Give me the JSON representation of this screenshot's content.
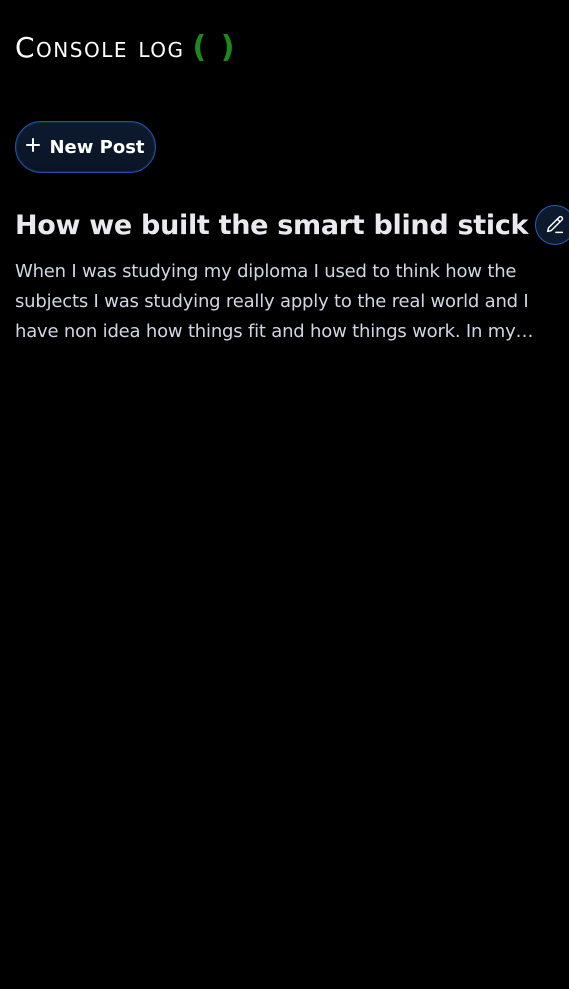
{
  "header": {
    "brand": "Console log",
    "brand_suffix": "( )"
  },
  "actions": {
    "new_post_label": "New Post"
  },
  "posts": [
    {
      "title": "How we built the smart blind stick",
      "excerpt": "When I was studying my diploma I used to think how the subjects I was studying really apply to the real world and I have non idea how things fit and how things work. In my…",
      "edit_icon": "pencil-icon"
    }
  ],
  "colors": {
    "background": "#000000",
    "accent_green": "#1b8a1b",
    "button_border": "#1f4fb3",
    "button_bg": "#0c1a2e",
    "title": "#e8eaf0",
    "excerpt": "#cfd6e4"
  }
}
